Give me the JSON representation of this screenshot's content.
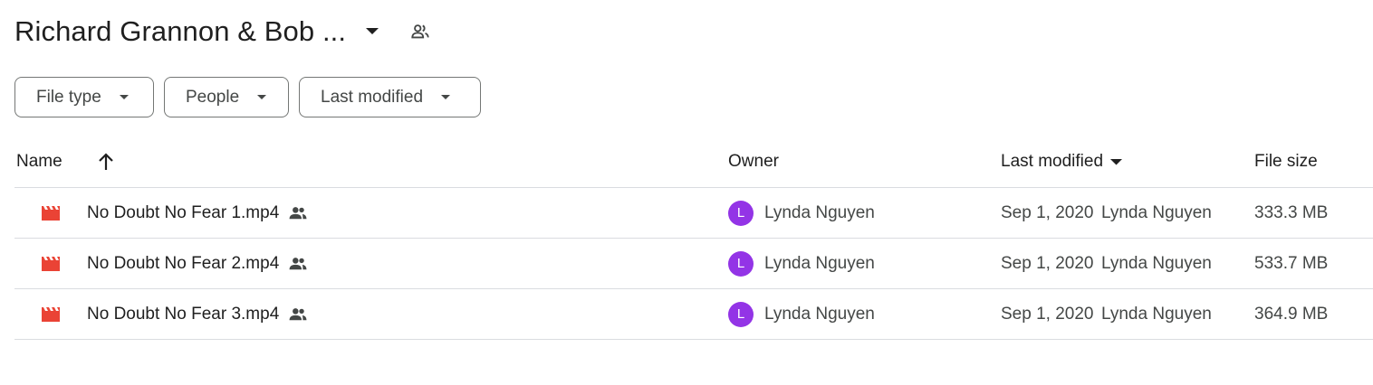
{
  "header": {
    "folder_title": "Richard Grannon & Bob ...",
    "dropdown_icon": "caret-down-icon",
    "shared_icon": "people-icon"
  },
  "filters": [
    {
      "label": "File type",
      "icon": "caret-down-icon"
    },
    {
      "label": "People",
      "icon": "caret-down-icon"
    },
    {
      "label": "Last modified",
      "icon": "caret-down-icon"
    }
  ],
  "table": {
    "columns": {
      "name": "Name",
      "owner": "Owner",
      "last_modified": "Last modified",
      "file_size": "File size"
    },
    "name_sort_icon": "arrow-up-icon",
    "rows": [
      {
        "name": "No Doubt No Fear 1.mp4",
        "owner": "Lynda Nguyen",
        "owner_initial": "L",
        "modified_date": "Sep 1, 2020",
        "modified_by": "Lynda Nguyen",
        "size": "333.3 MB"
      },
      {
        "name": "No Doubt No Fear 2.mp4",
        "owner": "Lynda Nguyen",
        "owner_initial": "L",
        "modified_date": "Sep 1, 2020",
        "modified_by": "Lynda Nguyen",
        "size": "533.7 MB"
      },
      {
        "name": "No Doubt No Fear 3.mp4",
        "owner": "Lynda Nguyen",
        "owner_initial": "L",
        "modified_date": "Sep 1, 2020",
        "modified_by": "Lynda Nguyen",
        "size": "364.9 MB"
      }
    ]
  },
  "colors": {
    "video_icon": "#ea4335",
    "avatar": "#9334e6",
    "divider": "#dadce0"
  }
}
